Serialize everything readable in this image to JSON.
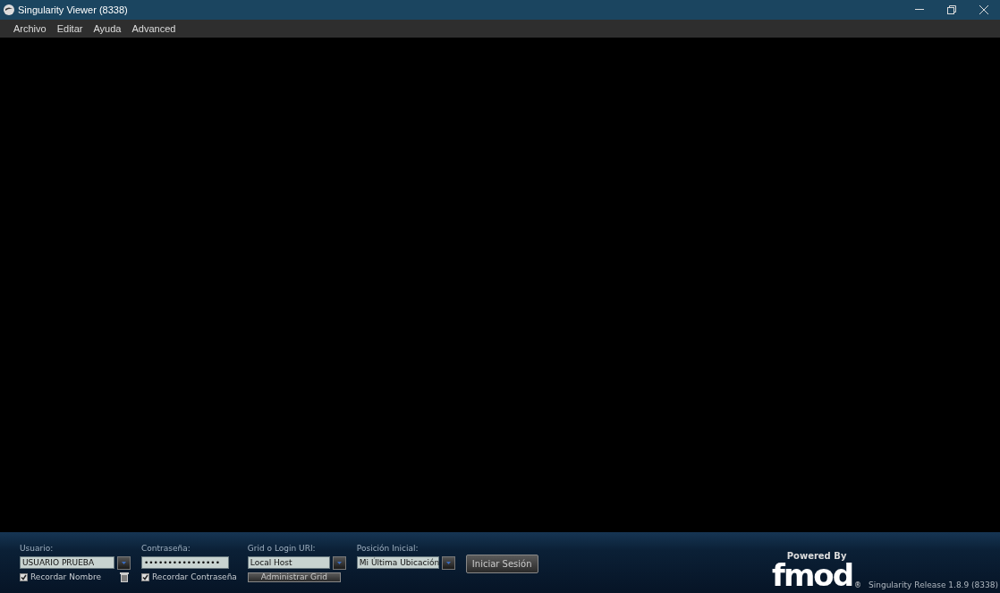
{
  "window": {
    "title": "Singularity Viewer (8338)"
  },
  "menu": [
    "Archivo",
    "Editar",
    "Ayuda",
    "Advanced"
  ],
  "login": {
    "username": {
      "label": "Usuario:",
      "value": "USUARIO PRUEBA"
    },
    "remember_name": {
      "label": "Recordar Nombre",
      "checked": true
    },
    "password": {
      "label": "Contraseña:",
      "value": "••••••••••••••••"
    },
    "remember_password": {
      "label": "Recordar Contraseña",
      "checked": true
    },
    "grid": {
      "label": "Grid o Login URI:",
      "value": "Local Host"
    },
    "manage_grid": "Administrar Grid",
    "start_location": {
      "label": "Posición Inicial:",
      "value": "Mi Última Ubicación"
    },
    "login_button": "Iniciar Sesión"
  },
  "branding": {
    "powered_by": "Powered By",
    "logo": "fmod",
    "registered": "®"
  },
  "version": "Singularity Release 1.8.9 (8338)"
}
